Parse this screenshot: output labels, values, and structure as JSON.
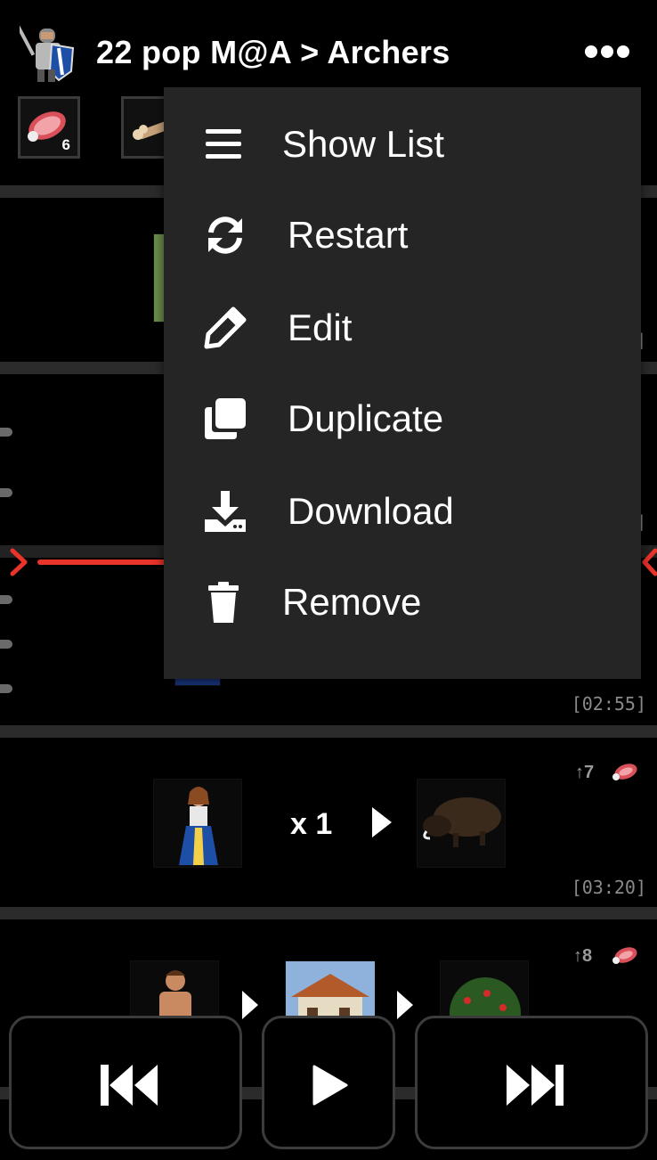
{
  "header": {
    "title": "22 pop M@A > Archers",
    "resources": [
      {
        "name": "food",
        "count": "6"
      },
      {
        "name": "wood",
        "count": ""
      }
    ]
  },
  "menu": {
    "items": [
      {
        "label": "Show List",
        "icon": "list-icon"
      },
      {
        "label": "Restart",
        "icon": "refresh-icon"
      },
      {
        "label": "Edit",
        "icon": "pencil-icon"
      },
      {
        "label": "Duplicate",
        "icon": "copy-icon"
      },
      {
        "label": "Download",
        "icon": "download-icon"
      },
      {
        "label": "Remove",
        "icon": "trash-icon"
      }
    ]
  },
  "steps": [
    {
      "time": "",
      "partial_time": "]"
    },
    {
      "time": "",
      "partial_time": "]"
    },
    {
      "time": "[02:55]"
    },
    {
      "time": "[03:20]",
      "pop": "↑7",
      "multiplier": "x 1",
      "resource": "food"
    },
    {
      "pop": "↑8",
      "resource": "food"
    }
  ],
  "controls": {
    "previous": "skip-back-icon",
    "play": "play-icon",
    "next": "skip-forward-icon"
  },
  "colors": {
    "background": "#000000",
    "menu_bg": "#252525",
    "separator": "#2b2b2b",
    "marker_red": "#e8342a",
    "time_text": "#8a8a8a"
  }
}
